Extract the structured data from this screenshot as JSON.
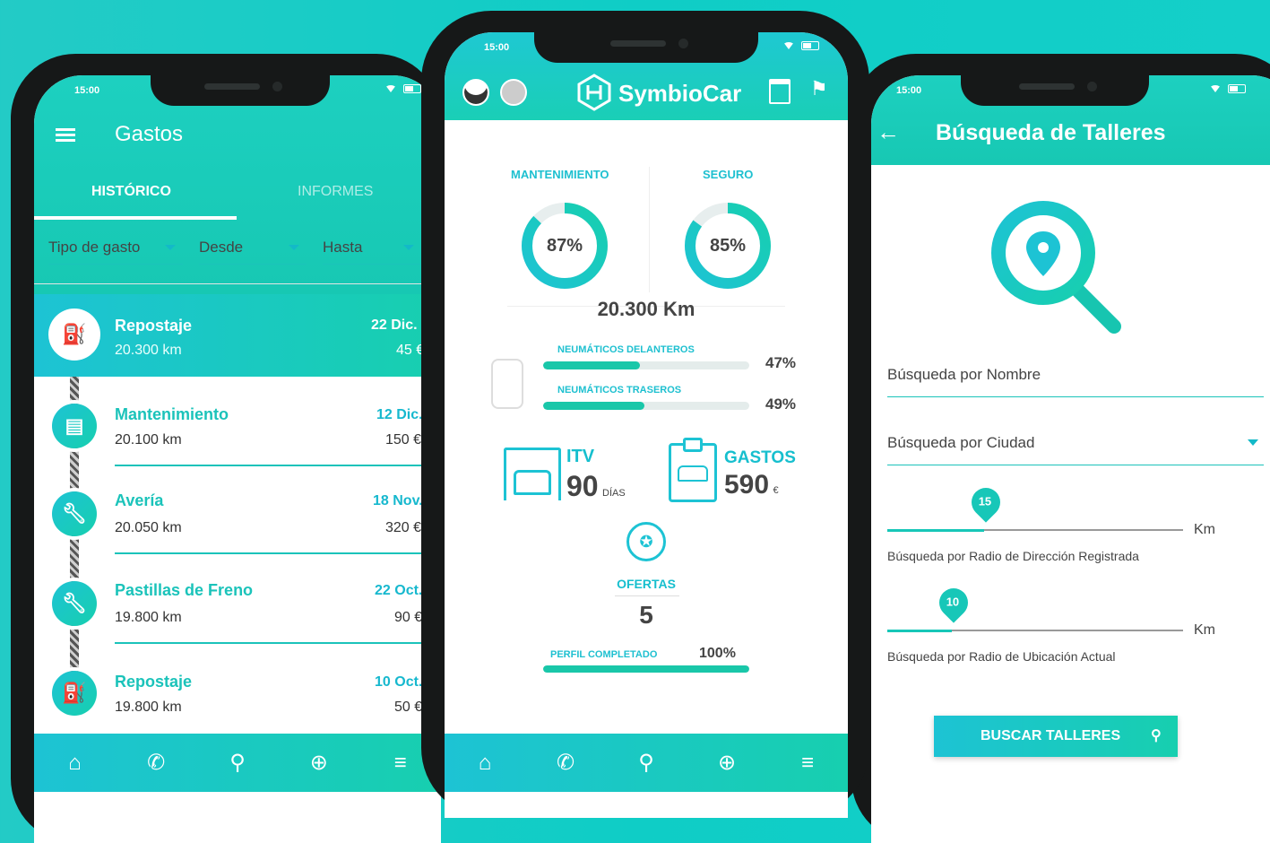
{
  "status_time": "15:00",
  "left": {
    "title": "Gastos",
    "tabs": [
      "HISTÓRICO",
      "INFORMES"
    ],
    "filters": [
      "Tipo de gasto",
      "Desde",
      "Hasta"
    ],
    "entries": [
      {
        "title": "Repostaje",
        "km": "20.300 km",
        "date": "22 Dic.",
        "amount": "45 €",
        "icon": "fuel-icon",
        "active": true
      },
      {
        "title": "Mantenimiento",
        "km": "20.100 km",
        "date": "12 Dic.",
        "amount": "150 €",
        "icon": "clipboard-icon"
      },
      {
        "title": "Avería",
        "km": "20.050 km",
        "date": "18 Nov.",
        "amount": "320 €",
        "icon": "wrench-icon"
      },
      {
        "title": "Pastillas de Freno",
        "km": "19.800 km",
        "date": "22 Oct.",
        "amount": "90 €",
        "icon": "wrench-icon"
      },
      {
        "title": "Repostaje",
        "km": "19.800 km",
        "date": "10 Oct.",
        "amount": "50 €",
        "icon": "fuel-icon"
      }
    ]
  },
  "middle": {
    "brand": "SymbioCar",
    "mantenimiento_label": "MANTENIMIENTO",
    "mantenimiento_pct": "87%",
    "mantenimiento_value": 87,
    "seguro_label": "SEGURO",
    "seguro_pct": "85%",
    "seguro_value": 85,
    "km": "20.300 Km",
    "tire_front_label": "NEUMÁTICOS DELANTEROS",
    "tire_front_pct": "47%",
    "tire_front_value": 47,
    "tire_rear_label": "NEUMÁTICOS TRASEROS",
    "tire_rear_pct": "49%",
    "tire_rear_value": 49,
    "itv_label": "ITV",
    "itv_value": "90",
    "itv_unit": "DÍAS",
    "gastos_label": "GASTOS",
    "gastos_value": "590",
    "gastos_unit": "€",
    "ofertas_label": "OFERTAS",
    "ofertas_value": "5",
    "perfil_label": "PERFIL COMPLETADO",
    "perfil_pct": "100%",
    "perfil_value": 100
  },
  "right": {
    "title": "Búsqueda de Talleres",
    "name_field": "Búsqueda por Nombre",
    "city_field": "Búsqueda por Ciudad",
    "slider1_value": "15",
    "slider1_unit": "Km",
    "slider1_label": "Búsqueda por Radio de Dirección Registrada",
    "slider2_value": "10",
    "slider2_unit": "Km",
    "slider2_label": "Búsqueda por Radio de Ubicación Actual",
    "search_button": "BUSCAR TALLERES"
  },
  "nav_icons": [
    "home-icon",
    "phone-icon",
    "search-icon",
    "add-icon",
    "menu-icon"
  ],
  "colors": {
    "accent": "#1bc3ba",
    "accent_blue": "#1dc3d4",
    "background": "#15cdc6"
  }
}
